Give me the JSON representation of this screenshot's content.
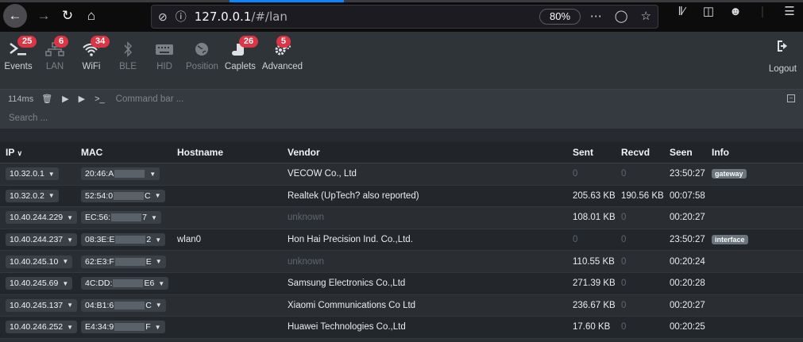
{
  "browser": {
    "url_host": "127.0.0.1",
    "url_path": "/#/lan",
    "zoom": "80%",
    "tab_colors": [
      "#3a3a3f",
      "#0a84ff",
      "#3a3a3f",
      "#3a3a3f"
    ]
  },
  "nav": {
    "items": [
      {
        "label": "Events",
        "badge": "25",
        "icon": "terminal-icon",
        "dim": false
      },
      {
        "label": "LAN",
        "badge": "6",
        "icon": "network-icon",
        "dim": true
      },
      {
        "label": "WiFi",
        "badge": "34",
        "icon": "wifi-icon",
        "dim": false
      },
      {
        "label": "BLE",
        "badge": "",
        "icon": "bluetooth-icon",
        "dim": true
      },
      {
        "label": "HID",
        "badge": "",
        "icon": "keyboard-icon",
        "dim": true
      },
      {
        "label": "Position",
        "badge": "",
        "icon": "globe-icon",
        "dim": true
      },
      {
        "label": "Caplets",
        "badge": "26",
        "icon": "scroll-icon",
        "dim": false
      },
      {
        "label": "Advanced",
        "badge": "5",
        "icon": "gears-icon",
        "dim": false
      }
    ],
    "logout_label": "Logout"
  },
  "command": {
    "latency": "114ms",
    "placeholder": "Command bar ...",
    "search_placeholder": "Search ..."
  },
  "table": {
    "headers": {
      "ip": "IP",
      "mac": "MAC",
      "hostname": "Hostname",
      "vendor": "Vendor",
      "sent": "Sent",
      "recvd": "Recvd",
      "seen": "Seen",
      "info": "Info"
    },
    "rows": [
      {
        "ip": "10.32.0.1",
        "mac_pre": "20:46:A",
        "mac_post": "",
        "hostname": "",
        "vendor": "VECOW Co., Ltd",
        "vendor_muted": false,
        "sent": "0",
        "sent_muted": true,
        "recvd": "0",
        "recvd_muted": true,
        "seen": "23:50:27",
        "info": "gateway"
      },
      {
        "ip": "10.32.0.2",
        "mac_pre": "52:54:0",
        "mac_post": "C",
        "hostname": "",
        "vendor": "Realtek (UpTech? also reported)",
        "vendor_muted": false,
        "sent": "205.63 KB",
        "sent_muted": false,
        "recvd": "190.56 KB",
        "recvd_muted": false,
        "seen": "00:07:58",
        "info": ""
      },
      {
        "ip": "10.40.244.229",
        "mac_pre": "EC:56:",
        "mac_post": "7",
        "hostname": "",
        "vendor": "unknown",
        "vendor_muted": true,
        "sent": "108.01 KB",
        "sent_muted": false,
        "recvd": "0",
        "recvd_muted": true,
        "seen": "00:20:27",
        "info": ""
      },
      {
        "ip": "10.40.244.237",
        "mac_pre": "08:3E:E",
        "mac_post": "2",
        "hostname": "wlan0",
        "vendor": "Hon Hai Precision Ind. Co.,Ltd.",
        "vendor_muted": false,
        "sent": "0",
        "sent_muted": true,
        "recvd": "0",
        "recvd_muted": true,
        "seen": "23:50:27",
        "info": "interface"
      },
      {
        "ip": "10.40.245.10",
        "mac_pre": "62:E3:F",
        "mac_post": "E",
        "hostname": "",
        "vendor": "unknown",
        "vendor_muted": true,
        "sent": "110.55 KB",
        "sent_muted": false,
        "recvd": "0",
        "recvd_muted": true,
        "seen": "00:20:24",
        "info": ""
      },
      {
        "ip": "10.40.245.69",
        "mac_pre": "4C:DD:",
        "mac_post": "E6",
        "hostname": "",
        "vendor": "Samsung Electronics Co.,Ltd",
        "vendor_muted": false,
        "sent": "271.39 KB",
        "sent_muted": false,
        "recvd": "0",
        "recvd_muted": true,
        "seen": "00:20:28",
        "info": ""
      },
      {
        "ip": "10.40.245.137",
        "mac_pre": "04:B1:6",
        "mac_post": "C",
        "hostname": "",
        "vendor": "Xiaomi Communications Co Ltd",
        "vendor_muted": false,
        "sent": "236.67 KB",
        "sent_muted": false,
        "recvd": "0",
        "recvd_muted": true,
        "seen": "00:20:27",
        "info": ""
      },
      {
        "ip": "10.40.246.252",
        "mac_pre": "E4:34:9",
        "mac_post": "F",
        "hostname": "",
        "vendor": "Huawei Technologies Co.,Ltd",
        "vendor_muted": false,
        "sent": "17.60 KB",
        "sent_muted": false,
        "recvd": "0",
        "recvd_muted": true,
        "seen": "00:20:25",
        "info": ""
      }
    ]
  }
}
